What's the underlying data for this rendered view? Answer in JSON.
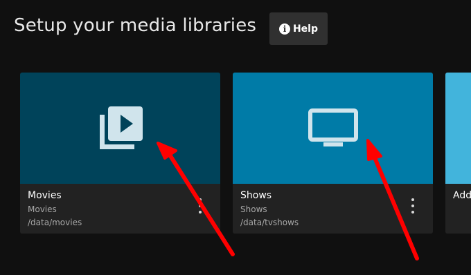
{
  "header": {
    "title": "Setup your media libraries",
    "help_label": "Help",
    "help_icon": "info-icon"
  },
  "libraries": [
    {
      "name": "Movies",
      "type": "Movies",
      "path": "/data/movies",
      "icon": "video-library-icon",
      "color": "#00435a"
    },
    {
      "name": "Shows",
      "type": "Shows",
      "path": "/data/tvshows",
      "icon": "tv-icon",
      "color": "#007ba7"
    },
    {
      "name": "Add Media Library",
      "label_visible": "Add",
      "icon": "add-icon",
      "color": "#42b4dc"
    }
  ],
  "colors": {
    "background": "#101010",
    "card_footer": "#222222",
    "icon_color": "#d0e4ec",
    "annotation_arrow": "#ff0000"
  }
}
